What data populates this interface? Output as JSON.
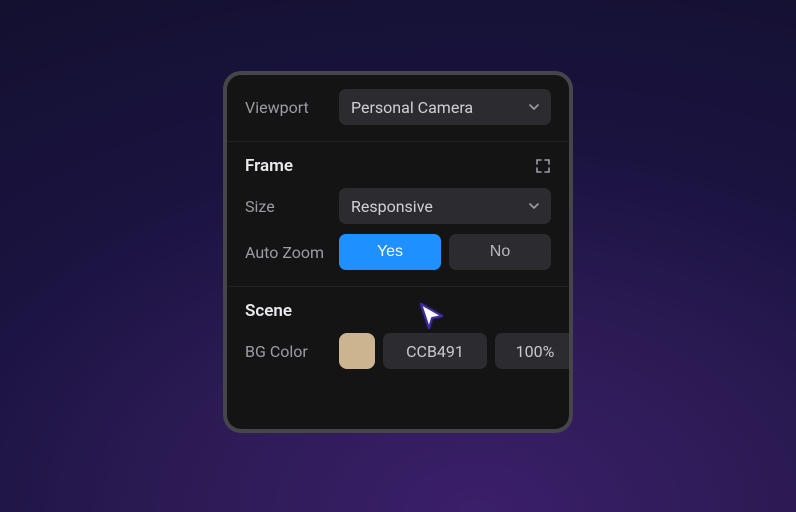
{
  "viewport": {
    "label": "Viewport",
    "select_value": "Personal Camera"
  },
  "frame": {
    "heading": "Frame",
    "size_label": "Size",
    "size_value": "Responsive",
    "autozoom_label": "Auto Zoom",
    "autozoom_yes": "Yes",
    "autozoom_no": "No",
    "autozoom_value": "Yes"
  },
  "scene": {
    "heading": "Scene",
    "bgcolor_label": "BG Color",
    "bgcolor_hex": "CCB491",
    "bgcolor_alpha": "100%",
    "bgcolor_swatch": "#ccb491"
  }
}
